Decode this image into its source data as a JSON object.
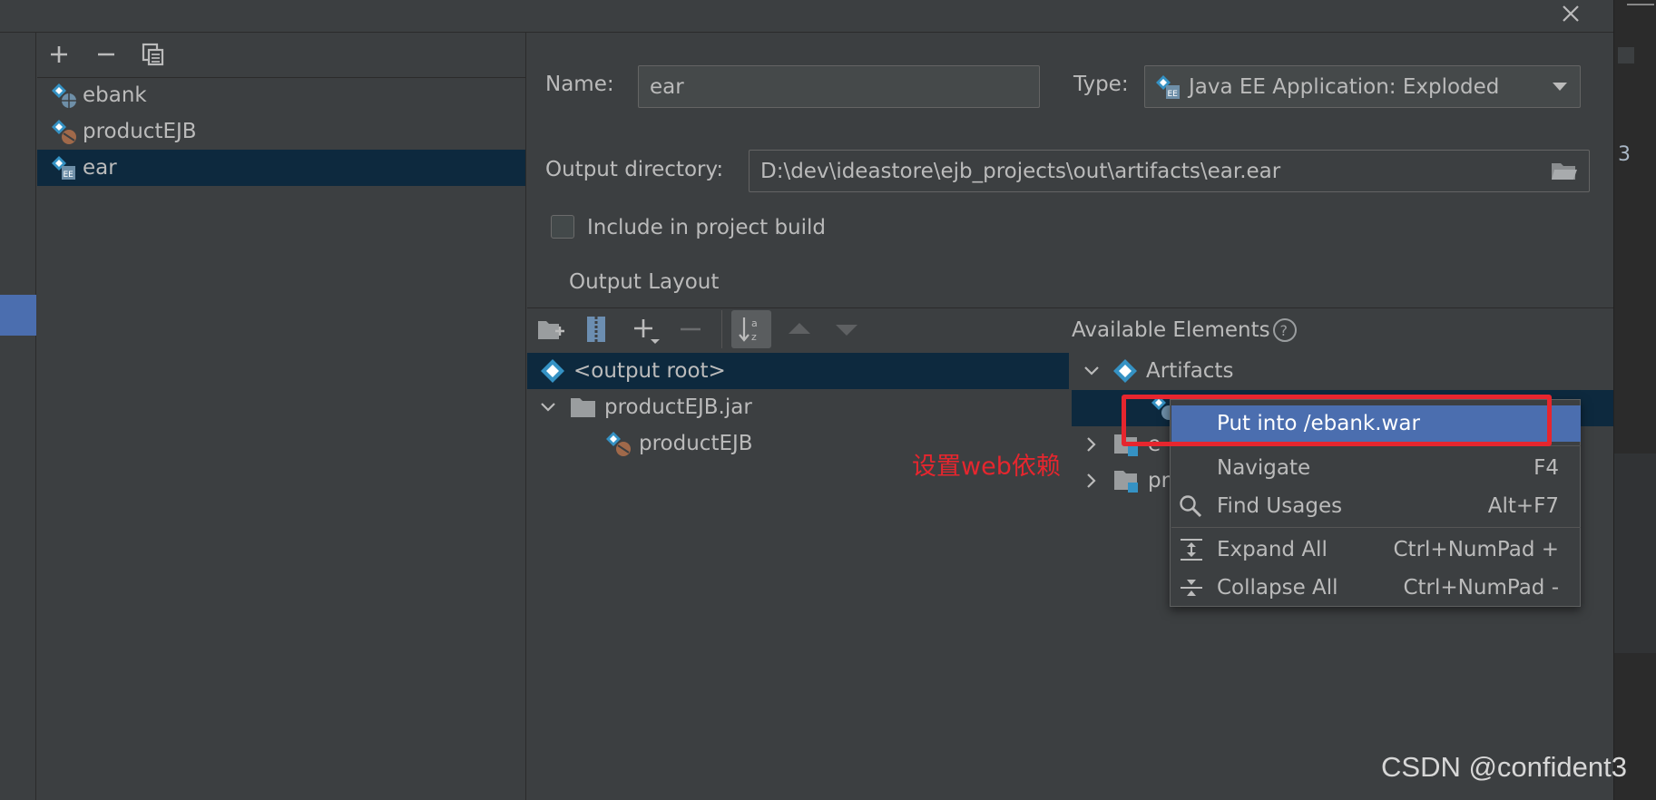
{
  "toolbar_left": {
    "add_icon": "plus-icon",
    "remove_icon": "minus-icon",
    "copy_icon": "copy-icon"
  },
  "artifacts": [
    {
      "label": "ebank",
      "icon": "web-artifact-icon"
    },
    {
      "label": "productEJB",
      "icon": "ejb-artifact-icon"
    },
    {
      "label": "ear",
      "icon": "ear-artifact-icon",
      "selected": true
    }
  ],
  "form": {
    "name_label": "Name:",
    "name_value": "ear",
    "type_label": "Type:",
    "type_value": "Java EE Application: Exploded",
    "output_dir_label": "Output directory:",
    "output_dir_value": "D:\\dev\\ideastore\\ejb_projects\\out\\artifacts\\ear.ear",
    "include_build_label": "Include in project build",
    "include_build_checked": false
  },
  "layout_tab": "Output Layout",
  "layout_tree": {
    "root": "<output root>",
    "jar": "productEJB.jar",
    "child": "productEJB"
  },
  "available": {
    "title": "Available Elements",
    "artifacts_label": "Artifacts",
    "hidden_row_fragment_1": "e",
    "hidden_row_fragment_2": "pr"
  },
  "context_menu": {
    "items": [
      {
        "label": "Put into /ebank.war",
        "shortcut": ""
      },
      {
        "label": "Navigate",
        "shortcut": "F4"
      },
      {
        "label": "Find Usages",
        "shortcut": "Alt+F7"
      },
      {
        "label": "Expand All",
        "shortcut": "Ctrl+NumPad +"
      },
      {
        "label": "Collapse All",
        "shortcut": "Ctrl+NumPad -"
      }
    ]
  },
  "annotation": "设置web依赖",
  "watermark": "CSDN @confident3",
  "editor_fragment": "3",
  "colors": {
    "background": "#3c3f41",
    "selection": "#0d293e",
    "menu_highlight": "#4b6eaf",
    "annotation_red": "#e6262e",
    "icon_blue": "#3592c4"
  }
}
